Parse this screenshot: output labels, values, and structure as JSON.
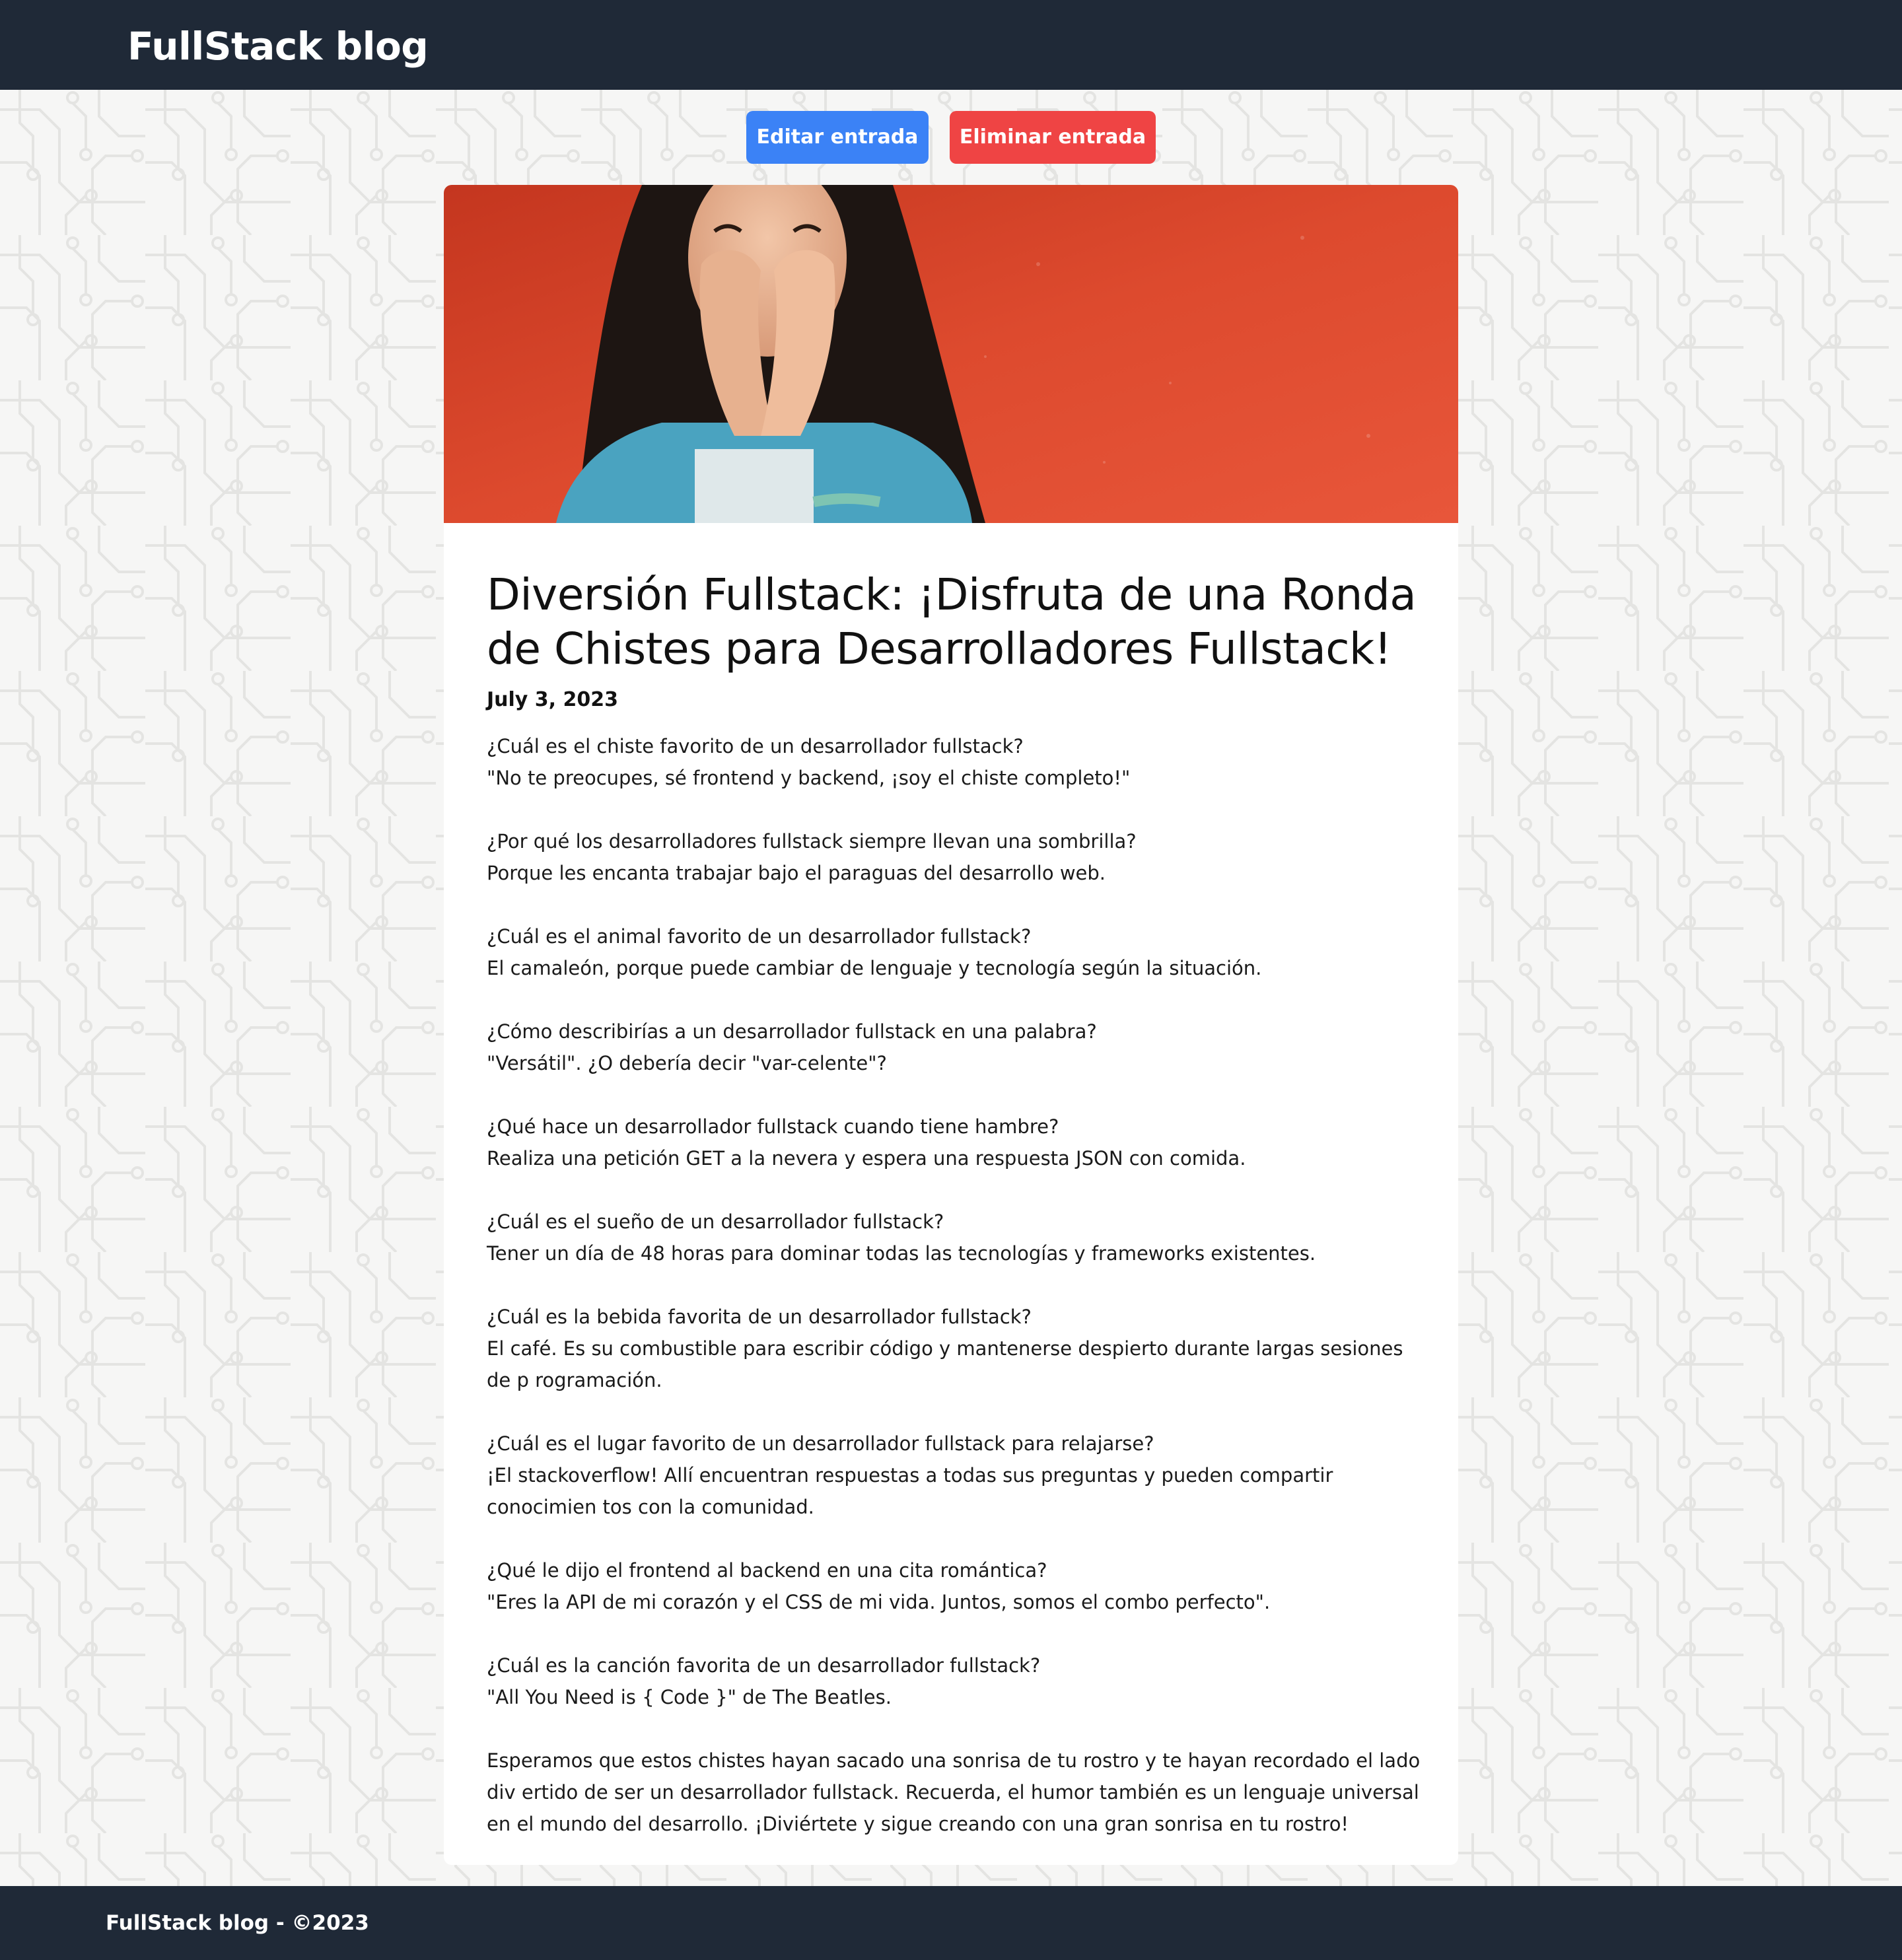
{
  "header": {
    "brand": "FullStack blog"
  },
  "actions": {
    "edit_label": "Editar entrada",
    "delete_label": "Eliminar entrada"
  },
  "colors": {
    "nav_bg": "#1f2937",
    "edit_button": "#3b82f6",
    "delete_button": "#ef4444",
    "hero_wall": "#d9442a"
  },
  "post": {
    "image_description": "woman laughing covering her face",
    "title": "Diversión Fullstack: ¡Disfruta de una Ronda de Chistes para Desarrolladores Fullstack!",
    "date": "July 3, 2023",
    "jokes": [
      {
        "question": "¿Cuál es el chiste favorito de un desarrollador fullstack?",
        "answer": "\"No te preocupes, sé frontend y backend, ¡soy el chiste completo!\""
      },
      {
        "question": "¿Por qué los desarrolladores fullstack siempre llevan una sombrilla?",
        "answer": "Porque les encanta trabajar bajo el paraguas del desarrollo web."
      },
      {
        "question": "¿Cuál es el animal favorito de un desarrollador fullstack?",
        "answer": "El camaleón, porque puede cambiar de lenguaje y tecnología según la situación."
      },
      {
        "question": "¿Cómo describirías a un desarrollador fullstack en una palabra?",
        "answer": "\"Versátil\". ¿O debería decir \"var-celente\"?"
      },
      {
        "question": "¿Qué hace un desarrollador fullstack cuando tiene hambre?",
        "answer": "Realiza una petición GET a la nevera y espera una respuesta JSON con comida."
      },
      {
        "question": "¿Cuál es el sueño de un desarrollador fullstack?",
        "answer": "Tener un día de 48 horas para dominar todas las tecnologías y frameworks existentes."
      },
      {
        "question": "¿Cuál es la bebida favorita de un desarrollador fullstack?",
        "answer": "El café. Es su combustible para escribir código y mantenerse despierto durante largas sesiones de p rogramación."
      },
      {
        "question": "¿Cuál es el lugar favorito de un desarrollador fullstack para relajarse?",
        "answer": "¡El stackoverflow! Allí encuentran respuestas a todas sus preguntas y pueden compartir conocimien tos con la comunidad."
      },
      {
        "question": "¿Qué le dijo el frontend al backend en una cita romántica?",
        "answer": "\"Eres la API de mi corazón y el CSS de mi vida. Juntos, somos el combo perfecto\"."
      },
      {
        "question": "¿Cuál es la canción favorita de un desarrollador fullstack?",
        "answer": "\"All You Need is { Code }\" de The Beatles."
      }
    ],
    "outro": "Esperamos que estos chistes hayan sacado una sonrisa de tu rostro y te hayan recordado el lado div ertido de ser un desarrollador fullstack. Recuerda, el humor también es un lenguaje universal en el mundo del desarrollo. ¡Diviértete y sigue creando con una gran sonrisa en tu rostro!"
  },
  "footer": {
    "text": "FullStack blog - ©2023"
  }
}
